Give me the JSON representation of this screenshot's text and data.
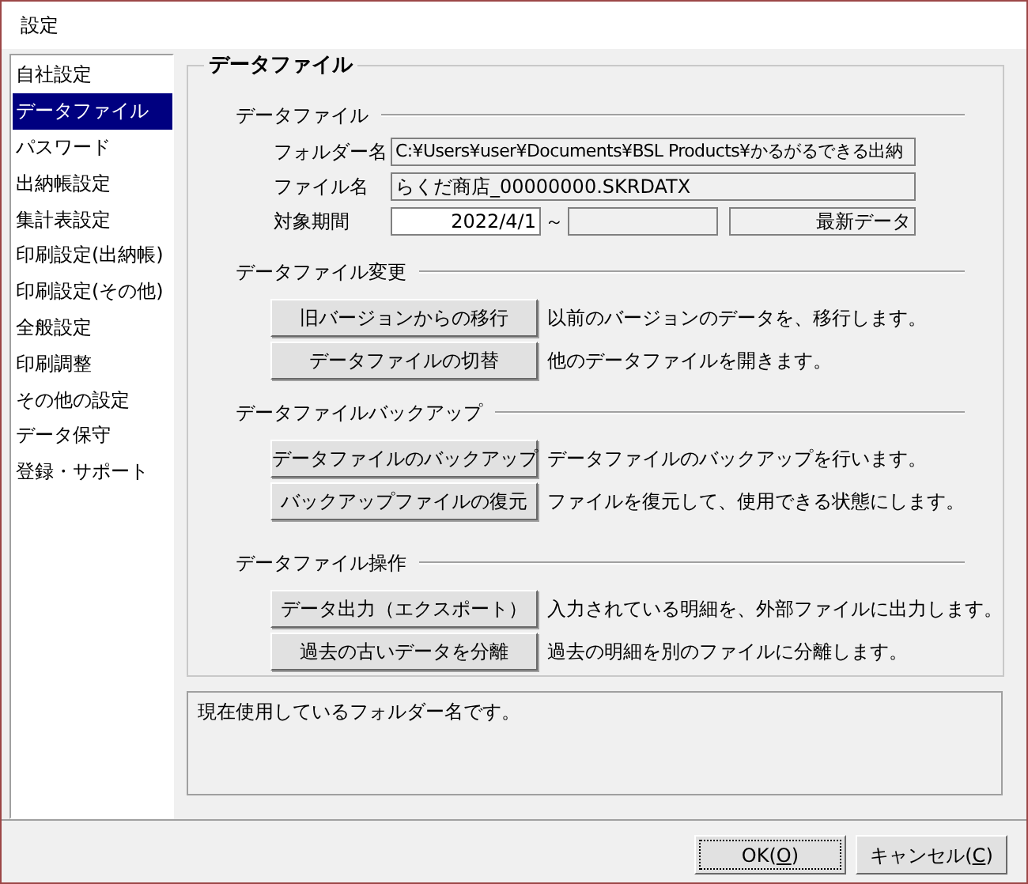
{
  "window": {
    "title": "設定"
  },
  "sidebar": {
    "items": [
      {
        "label": "自社設定",
        "selected": false
      },
      {
        "label": "データファイル",
        "selected": true
      },
      {
        "label": "パスワード",
        "selected": false
      },
      {
        "label": "出納帳設定",
        "selected": false
      },
      {
        "label": "集計表設定",
        "selected": false
      },
      {
        "label": "印刷設定(出納帳)",
        "selected": false
      },
      {
        "label": "印刷設定(その他)",
        "selected": false
      },
      {
        "label": "全般設定",
        "selected": false
      },
      {
        "label": "印刷調整",
        "selected": false
      },
      {
        "label": "その他の設定",
        "selected": false
      },
      {
        "label": "データ保守",
        "selected": false
      },
      {
        "label": "登録・サポート",
        "selected": false
      }
    ]
  },
  "panel": {
    "title": "データファイル",
    "data_file": {
      "title": "データファイル",
      "folder": {
        "label": "フォルダー名",
        "value": "C:¥Users¥user¥Documents¥BSL Products¥かるがるできる出納"
      },
      "file": {
        "label": "ファイル名",
        "value": "らくだ商店_00000000.SKRDATX"
      },
      "period": {
        "label": "対象期間",
        "from": "2022/4/1",
        "separator": "～",
        "to_note": "最新データ"
      }
    },
    "sections": [
      {
        "title": "データファイル変更",
        "actions": [
          {
            "button": "旧バージョンからの移行",
            "description": "以前のバージョンのデータを、移行します。"
          },
          {
            "button": "データファイルの切替",
            "description": "他のデータファイルを開きます。"
          }
        ]
      },
      {
        "title": "データファイルバックアップ",
        "actions": [
          {
            "button": "データファイルのバックアップ",
            "description": "データファイルのバックアップを行います。"
          },
          {
            "button": "バックアップファイルの復元",
            "description": "ファイルを復元して、使用できる状態にします。"
          }
        ]
      },
      {
        "title": "データファイル操作",
        "actions": [
          {
            "button": "データ出力（エクスポート）",
            "description": "入力されている明細を、外部ファイルに出力します。"
          },
          {
            "button": "過去の古いデータを分離",
            "description": "過去の明細を別のファイルに分離します。"
          }
        ]
      }
    ]
  },
  "description": "現在使用しているフォルダー名です。",
  "buttons": [
    {
      "before": "OK(",
      "accel": "O",
      "after": ")",
      "focused": true
    },
    {
      "before": "キャンセル(",
      "accel": "C",
      "after": ")",
      "focused": false
    }
  ]
}
